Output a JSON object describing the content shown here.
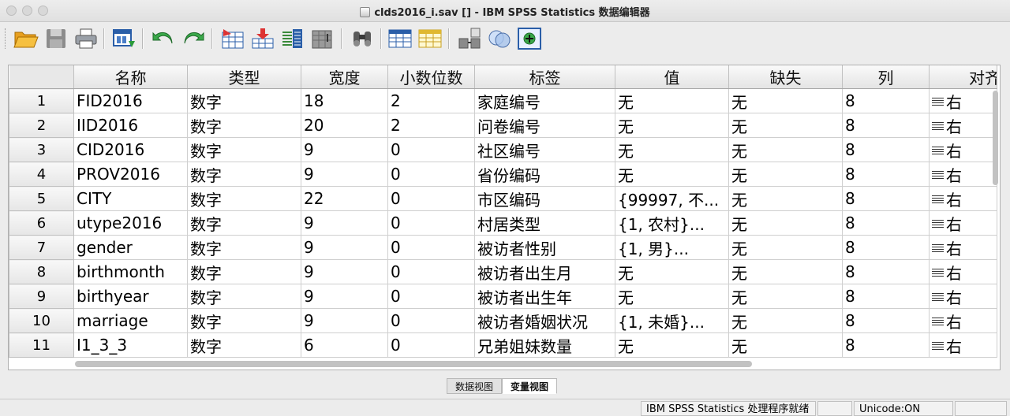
{
  "window": {
    "title": "clds2016_i.sav [] - IBM SPSS Statistics 数据编辑器"
  },
  "toolbar": {
    "buttons": [
      {
        "name": "open-file",
        "icon": "folder-open-icon"
      },
      {
        "name": "save",
        "icon": "floppy-disk-icon"
      },
      {
        "name": "print",
        "icon": "printer-icon"
      },
      {
        "name": "recall-dialog",
        "icon": "dialog-recall-icon"
      },
      {
        "name": "undo",
        "icon": "undo-arrow-icon"
      },
      {
        "name": "redo",
        "icon": "redo-arrow-icon"
      },
      {
        "name": "goto-case",
        "icon": "goto-case-icon"
      },
      {
        "name": "goto-variable",
        "icon": "goto-variable-icon"
      },
      {
        "name": "variables",
        "icon": "variables-icon"
      },
      {
        "name": "run-descriptives",
        "icon": "chart-icon"
      },
      {
        "name": "find",
        "icon": "binoculars-icon"
      },
      {
        "name": "insert-cases",
        "icon": "insert-cases-icon"
      },
      {
        "name": "insert-variable",
        "icon": "insert-variable-icon"
      },
      {
        "name": "split-file",
        "icon": "split-file-icon"
      },
      {
        "name": "select-cases",
        "icon": "circles-icon"
      },
      {
        "name": "value-labels",
        "icon": "value-labels-icon"
      }
    ]
  },
  "grid": {
    "columns": [
      "名称",
      "类型",
      "宽度",
      "小数位数",
      "标签",
      "值",
      "缺失",
      "列",
      "对齐"
    ],
    "rows": [
      {
        "num": "1",
        "name": "FID2016",
        "type": "数字",
        "width": "18",
        "decimals": "2",
        "label": "家庭编号",
        "values": "无",
        "missing": "无",
        "columns": "8",
        "align": "右"
      },
      {
        "num": "2",
        "name": "IID2016",
        "type": "数字",
        "width": "20",
        "decimals": "2",
        "label": "问卷编号",
        "values": "无",
        "missing": "无",
        "columns": "8",
        "align": "右"
      },
      {
        "num": "3",
        "name": "CID2016",
        "type": "数字",
        "width": "9",
        "decimals": "0",
        "label": "社区编号",
        "values": "无",
        "missing": "无",
        "columns": "8",
        "align": "右"
      },
      {
        "num": "4",
        "name": "PROV2016",
        "type": "数字",
        "width": "9",
        "decimals": "0",
        "label": "省份编码",
        "values": "无",
        "missing": "无",
        "columns": "8",
        "align": "右"
      },
      {
        "num": "5",
        "name": "CITY",
        "type": "数字",
        "width": "22",
        "decimals": "0",
        "label": "市区编码",
        "values": "{99997, 不...",
        "missing": "无",
        "columns": "8",
        "align": "右"
      },
      {
        "num": "6",
        "name": "utype2016",
        "type": "数字",
        "width": "9",
        "decimals": "0",
        "label": "村居类型",
        "values": "{1, 农村}...",
        "missing": "无",
        "columns": "8",
        "align": "右"
      },
      {
        "num": "7",
        "name": "gender",
        "type": "数字",
        "width": "9",
        "decimals": "0",
        "label": "被访者性别",
        "values": "{1, 男}...",
        "missing": "无",
        "columns": "8",
        "align": "右"
      },
      {
        "num": "8",
        "name": "birthmonth",
        "type": "数字",
        "width": "9",
        "decimals": "0",
        "label": "被访者出生月",
        "values": "无",
        "missing": "无",
        "columns": "8",
        "align": "右"
      },
      {
        "num": "9",
        "name": "birthyear",
        "type": "数字",
        "width": "9",
        "decimals": "0",
        "label": "被访者出生年",
        "values": "无",
        "missing": "无",
        "columns": "8",
        "align": "右"
      },
      {
        "num": "10",
        "name": "marriage",
        "type": "数字",
        "width": "9",
        "decimals": "0",
        "label": "被访者婚姻状况",
        "values": "{1, 未婚}...",
        "missing": "无",
        "columns": "8",
        "align": "右"
      },
      {
        "num": "11",
        "name": "I1_3_3",
        "type": "数字",
        "width": "6",
        "decimals": "0",
        "label": "兄弟姐妹数量",
        "values": "无",
        "missing": "无",
        "columns": "8",
        "align": "右"
      }
    ]
  },
  "tabs": [
    {
      "label": "数据视图",
      "active": false
    },
    {
      "label": "变量视图",
      "active": true
    }
  ],
  "status": {
    "processor": "IBM SPSS Statistics 处理程序就绪",
    "unicode": "Unicode:ON"
  }
}
